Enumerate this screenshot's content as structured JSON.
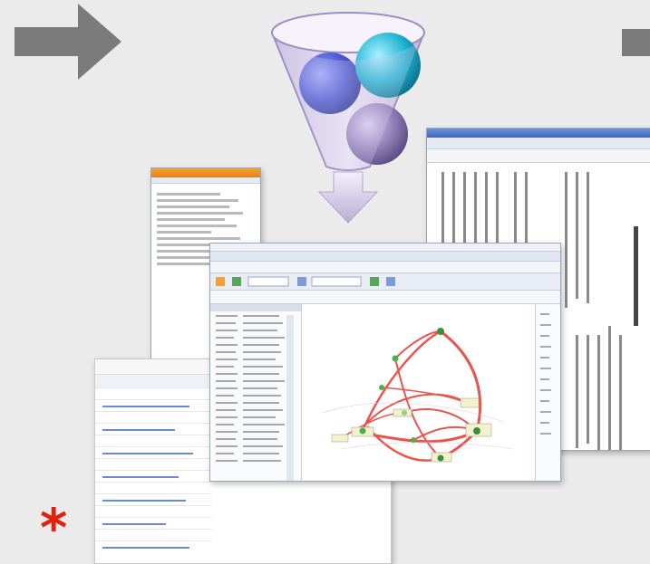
{
  "colors": {
    "background": "#ebebeb",
    "arrow": "#7b7b7b",
    "asterisk": "#e4200c",
    "sphere_blue": "#4b5ad0",
    "sphere_cyan": "#1fb3d2",
    "sphere_purple": "#8f7fb8",
    "graph_edge": "#e8372f"
  },
  "icons": {
    "left_arrow": "right-arrow-icon",
    "right_arrow": "right-arrow-icon",
    "funnel": "funnel-icon",
    "asterisk": "asterisk-icon"
  },
  "asterisk_mark": "*"
}
